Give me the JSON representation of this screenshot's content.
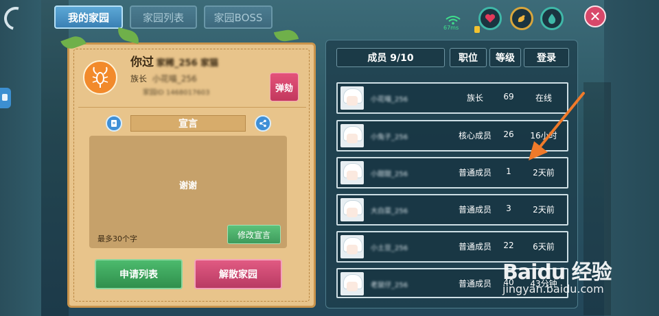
{
  "tabs": [
    {
      "label": "我的家园",
      "active": true
    },
    {
      "label": "家园列表",
      "active": false
    },
    {
      "label": "家园BOSS",
      "active": false
    }
  ],
  "status": {
    "ping": "67ms",
    "colors": {
      "heart": "#e23a5a",
      "stamina": "#f0b43c",
      "water": "#3fb8a8"
    }
  },
  "family": {
    "name_visible": "你过",
    "name_blurred": "家稀_256 家猫",
    "leader_label": "族长",
    "leader_name_blurred": "小花喵_256",
    "id_blurred": "家园ID 1468017603",
    "impeach_label": "弹劾"
  },
  "declaration": {
    "header": "宣言",
    "text": "谢谢",
    "max_hint": "最多30个字",
    "modify_label": "修改宣言"
  },
  "buttons": {
    "apply_list": "申请列表",
    "dissolve": "解散家园"
  },
  "members": {
    "header": {
      "count": "成员 9/10",
      "position": "职位",
      "level": "等级",
      "login": "登录"
    },
    "rows": [
      {
        "nick": "小花喵_256",
        "position": "族长",
        "level": "69",
        "login": "在线"
      },
      {
        "nick": "小兔子_256",
        "position": "核心成员",
        "level": "26",
        "login": "16小时"
      },
      {
        "nick": "小甜甜_256",
        "position": "普通成员",
        "level": "1",
        "login": "2天前"
      },
      {
        "nick": "大白菜_256",
        "position": "普通成员",
        "level": "3",
        "login": "2天前"
      },
      {
        "nick": "小土豆_256",
        "position": "普通成员",
        "level": "22",
        "login": "6天前"
      },
      {
        "nick": "老鼠仔_256",
        "position": "普通成员",
        "level": "40",
        "login": "43分钟"
      }
    ]
  },
  "watermark": {
    "brand": "Baidu 经验",
    "site": "jingyan.baidu.com"
  },
  "colors": {
    "arrow": "#f07a2a"
  }
}
